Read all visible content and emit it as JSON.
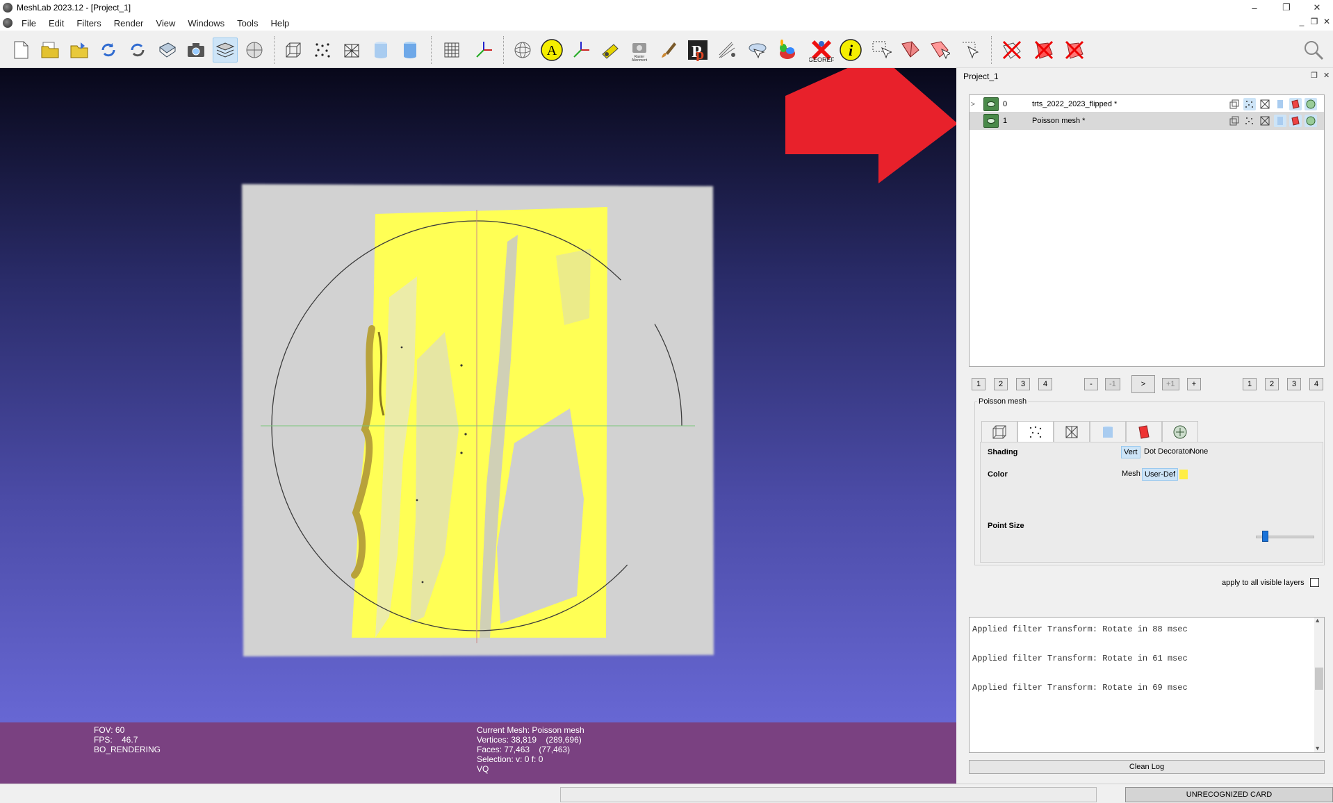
{
  "window": {
    "title": "MeshLab 2023.12 - [Project_1]",
    "min": "–",
    "restore": "❐",
    "close": "✕",
    "mdi_min": "_",
    "mdi_restore": "❐",
    "mdi_close": "✕"
  },
  "menu": [
    "File",
    "Edit",
    "Filters",
    "Render",
    "View",
    "Windows",
    "Tools",
    "Help"
  ],
  "toolbar_labels": {
    "georef": "GEOREF",
    "raster": "Raster Alignment",
    "letter_a": "A",
    "info": "i"
  },
  "info_left": {
    "fov": "FOV: 60",
    "fps": "FPS:    46.7",
    "mode": "BO_RENDERING"
  },
  "info_mid": {
    "mesh": "Current Mesh: Poisson mesh",
    "vertices": "Vertices: 38,819    (289,696)",
    "faces": "Faces: 77,463    (77,463)",
    "selection": "Selection: v: 0 f: 0",
    "vq": "VQ"
  },
  "dock": {
    "title": "Project_1",
    "float": "❐",
    "close": "✕"
  },
  "layers": [
    {
      "arrow": ">",
      "index": "0",
      "name": "trts_2022_2023_flipped *"
    },
    {
      "arrow": "",
      "index": "1",
      "name": "Poisson mesh *"
    }
  ],
  "nav": {
    "left": [
      "1",
      "2",
      "3",
      "4"
    ],
    "minus": "-",
    "minus1": "-1",
    "next": ">",
    "plus1": "+1",
    "plus": "+",
    "right": [
      "1",
      "2",
      "3",
      "4"
    ]
  },
  "render_panel": {
    "title": "Poisson mesh",
    "shading_label": "Shading",
    "shading_opts": [
      "Vert",
      "Dot Decorator",
      "None"
    ],
    "color_label": "Color",
    "color_opts": [
      "Mesh",
      "User-Def"
    ],
    "user_color": "#ffee44",
    "point_size_label": "Point Size",
    "point_size_value": 0.15,
    "apply_all": "apply to all visible layers"
  },
  "log": [
    "Applied filter Transform: Rotate in 88 msec",
    "Applied filter Transform: Rotate in 61 msec",
    "Applied filter Transform: Rotate in 69 msec"
  ],
  "log_scroll": {
    "up": "▲",
    "down": "▼"
  },
  "clean_log": "Clean Log",
  "status": {
    "card": "UNRECOGNIZED CARD"
  },
  "colors": {
    "viewport_top": "#08081a",
    "viewport_bottom": "#6f6fe0",
    "info_bar": "#7a4181",
    "mesh_yellow": "#ffff55",
    "arrow_red": "#e8212b"
  }
}
